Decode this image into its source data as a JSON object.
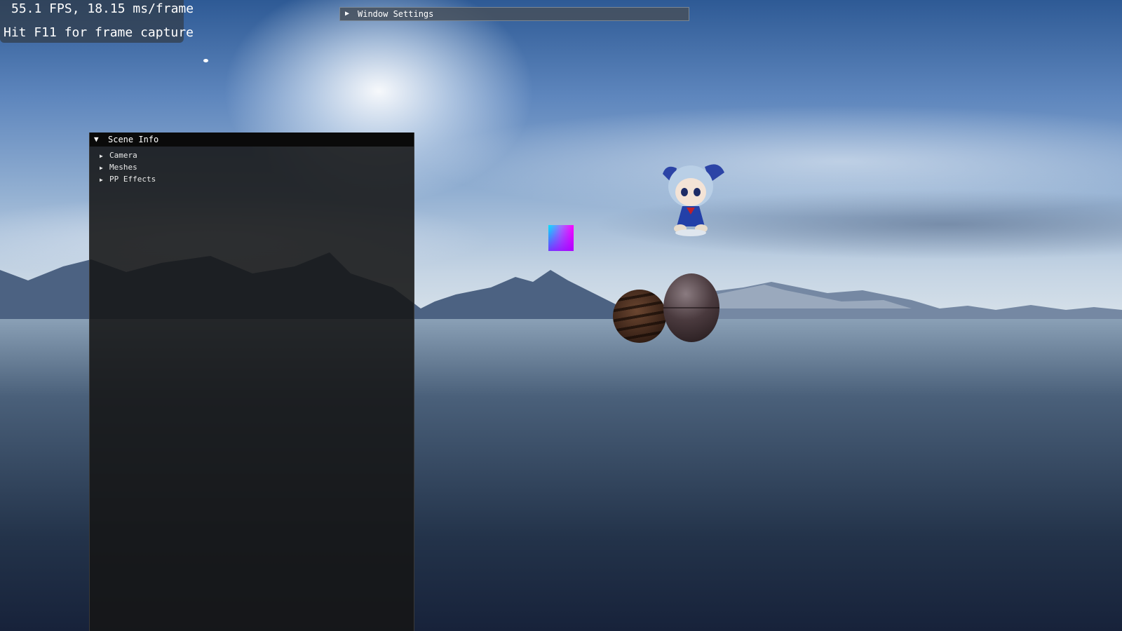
{
  "viewport": {
    "scene": "lake-skybox-3d-scene",
    "stats": {
      "fps_line": "55.1 FPS, 18.15 ms/frame",
      "capture_hint": "Hit F11 for frame capture"
    }
  },
  "window_settings": {
    "title": "Window Settings",
    "collapsed": true,
    "arrow": "▶"
  },
  "scene_info": {
    "title": "Scene Info",
    "collapsed": false,
    "arrow": "▼",
    "items": [
      {
        "label": "Camera",
        "arrow": "▶"
      },
      {
        "label": "Meshes",
        "arrow": "▶"
      },
      {
        "label": "PP Effects",
        "arrow": "▶"
      }
    ]
  },
  "objects": {
    "quad": "gradient-color-quad",
    "sphere_1": "wood-textured-sphere",
    "sphere_2": "metallic-sphere",
    "model": "plush-doll-model"
  },
  "colors": {
    "overlay_bg": "#323c46",
    "panel_bg": "#161616",
    "titlebar_bg": "#0a0a0a",
    "text": "#ffffff"
  }
}
